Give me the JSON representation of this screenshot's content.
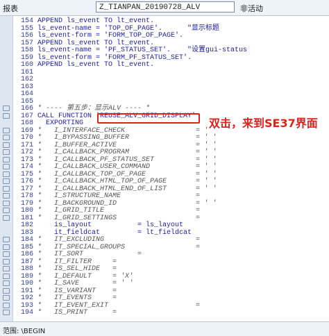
{
  "header": {
    "label": "报表",
    "program": "Z_TIANPAN_20190728_ALV",
    "status": "非活动"
  },
  "annotation": {
    "text": "双击，来到SE37界面",
    "color": "#e0201a"
  },
  "status_bar": {
    "text": "范围: \\BEGIN"
  },
  "lines": [
    {
      "num": "154",
      "text": "APPEND ls_event TO lt_event."
    },
    {
      "num": "155",
      "text": "ls_event-name = 'TOP_OF_PAGE'.      \"显示标题"
    },
    {
      "num": "156",
      "text": "ls_event-form = 'FORM_TOP_OF_PAGE'."
    },
    {
      "num": "157",
      "text": "APPEND ls_event TO lt_event."
    },
    {
      "num": "158",
      "text": "ls_event-name = 'PF_STATUS_SET'.    \"设置gui-status"
    },
    {
      "num": "159",
      "text": "ls_event-form = 'FORM_PF_STATUS_SET'."
    },
    {
      "num": "160",
      "text": "APPEND ls_event TO lt_event."
    },
    {
      "num": "161",
      "text": ""
    },
    {
      "num": "162",
      "text": ""
    },
    {
      "num": "163",
      "text": ""
    },
    {
      "num": "164",
      "text": ""
    },
    {
      "num": "165",
      "text": ""
    },
    {
      "num": "166",
      "text": "* ---- 第五步：显示ALV ---- *"
    },
    {
      "num": "167",
      "text": "CALL FUNCTION 'REUSE_ALV_GRID_DISPLAY'"
    },
    {
      "num": "168",
      "text": "  EXPORTING"
    },
    {
      "num": "169",
      "text": "*   I_INTERFACE_CHECK                 = ' '"
    },
    {
      "num": "170",
      "text": "*   I_BYPASSING_BUFFER                = ' '"
    },
    {
      "num": "171",
      "text": "*   I_BUFFER_ACTIVE                   = ' '"
    },
    {
      "num": "172",
      "text": "*   I_CALLBACK_PROGRAM                = ' '"
    },
    {
      "num": "173",
      "text": "*   I_CALLBACK_PF_STATUS_SET          = ' '"
    },
    {
      "num": "174",
      "text": "*   I_CALLBACK_USER_COMMAND           = ' '"
    },
    {
      "num": "175",
      "text": "*   I_CALLBACK_TOP_OF_PAGE            = ' '"
    },
    {
      "num": "176",
      "text": "*   I_CALLBACK_HTML_TOP_OF_PAGE       = ' '"
    },
    {
      "num": "177",
      "text": "*   I_CALLBACK_HTML_END_OF_LIST       = ' '"
    },
    {
      "num": "178",
      "text": "*   I_STRUCTURE_NAME                  ="
    },
    {
      "num": "179",
      "text": "*   I_BACKGROUND_ID                   = ' '"
    },
    {
      "num": "180",
      "text": "*   I_GRID_TITLE                      ="
    },
    {
      "num": "181",
      "text": "*   I_GRID_SETTINGS                   ="
    },
    {
      "num": "182",
      "text": "    is_layout           = ls_layout"
    },
    {
      "num": "183",
      "text": "    it_fieldcat         = lt_fieldcat"
    },
    {
      "num": "184",
      "text": "*   IT_EXCLUDING                      ="
    },
    {
      "num": "185",
      "text": "*   IT_SPECIAL_GROUPS                 ="
    },
    {
      "num": "186",
      "text": "*   IT_SORT             ="
    },
    {
      "num": "187",
      "text": "*   IT_FILTER     ="
    },
    {
      "num": "188",
      "text": "*   IS_SEL_HIDE   ="
    },
    {
      "num": "189",
      "text": "*   I_DEFAULT     = 'X'"
    },
    {
      "num": "190",
      "text": "*   I_SAVE        = ' '"
    },
    {
      "num": "191",
      "text": "*   IS_VARIANT    ="
    },
    {
      "num": "192",
      "text": "*   IT_EVENTS     ="
    },
    {
      "num": "193",
      "text": "*   IT_EVENT_EXIT                     ="
    },
    {
      "num": "194",
      "text": "*   IS_PRINT      ="
    }
  ]
}
